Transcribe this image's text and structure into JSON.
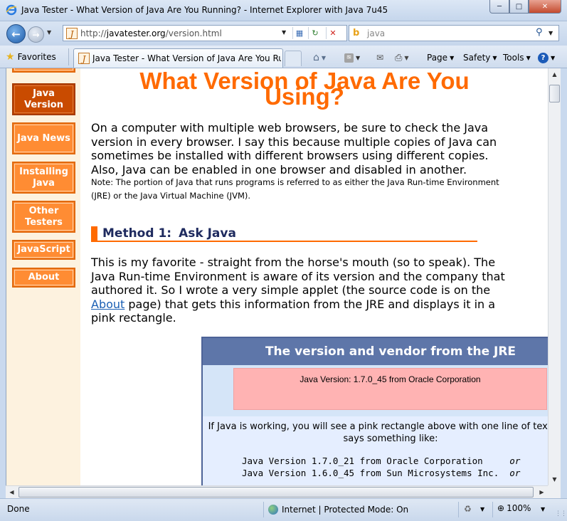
{
  "window": {
    "title": "Java Tester - What Version of Java Are You Running? - Internet Explorer with Java 7u45",
    "minimize": "─",
    "maximize": "□",
    "close": "✕"
  },
  "address": {
    "prefix": "http://",
    "domain": "javatester.org",
    "path": "/version.html"
  },
  "search": {
    "value": "java",
    "engine_icon": "bing-icon"
  },
  "toolbar": {
    "favorites_label": "Favorites",
    "tab_label": "Java Tester - What Version of Java Are You Runn...",
    "page_label": "Page",
    "safety_label": "Safety",
    "tools_label": "Tools"
  },
  "sidebar": {
    "items": [
      {
        "label": "Java Version",
        "active": true
      },
      {
        "label": "Java News",
        "active": false
      },
      {
        "label": "Installing Java",
        "active": false
      },
      {
        "label": "Other Testers",
        "active": false
      },
      {
        "label": "JavaScript",
        "active": false
      },
      {
        "label": "About",
        "active": false
      }
    ]
  },
  "content": {
    "title_line1": "What Version of Java Are You",
    "title_line2": "Using?",
    "intro": "On a computer with multiple web browsers, be sure to check the Java version in every browser. I say this because multiple copies of Java can sometimes be installed with different browsers using different copies. Also, Java can be enabled in one browser and disabled in another.",
    "note": "Note: The portion of Java that runs programs is referred to as either the Java Run-time Environment (JRE) or the Java Virtual Machine (JVM).",
    "method_number": "Method 1:",
    "method_title": "Ask Java",
    "p2_before": "This is my favorite - straight from the horse's mouth (so to speak). The Java Run-time Environment is aware of its version and the company that authored it. So I wrote a very simple applet (the source code is on the ",
    "p2_link": "About",
    "p2_after": " page) that gets this information from the JRE and displays it in a pink rectangle.",
    "jre_header": "The version and vendor from the JRE",
    "jre_result": "Java Version: 1.7.0_45  from Oracle Corporation",
    "jre_desc": "If Java is working, you will see a pink rectangle above with one line of text that says something like:",
    "example1": "Java Version 1.7.0_21 from Oracle Corporation     ",
    "example2": "Java Version 1.6.0_45 from Sun Microsystems Inc.  ",
    "or_word": "or"
  },
  "status": {
    "left": "Done",
    "zone": "Internet | Protected Mode: On",
    "zoom": "100%"
  }
}
